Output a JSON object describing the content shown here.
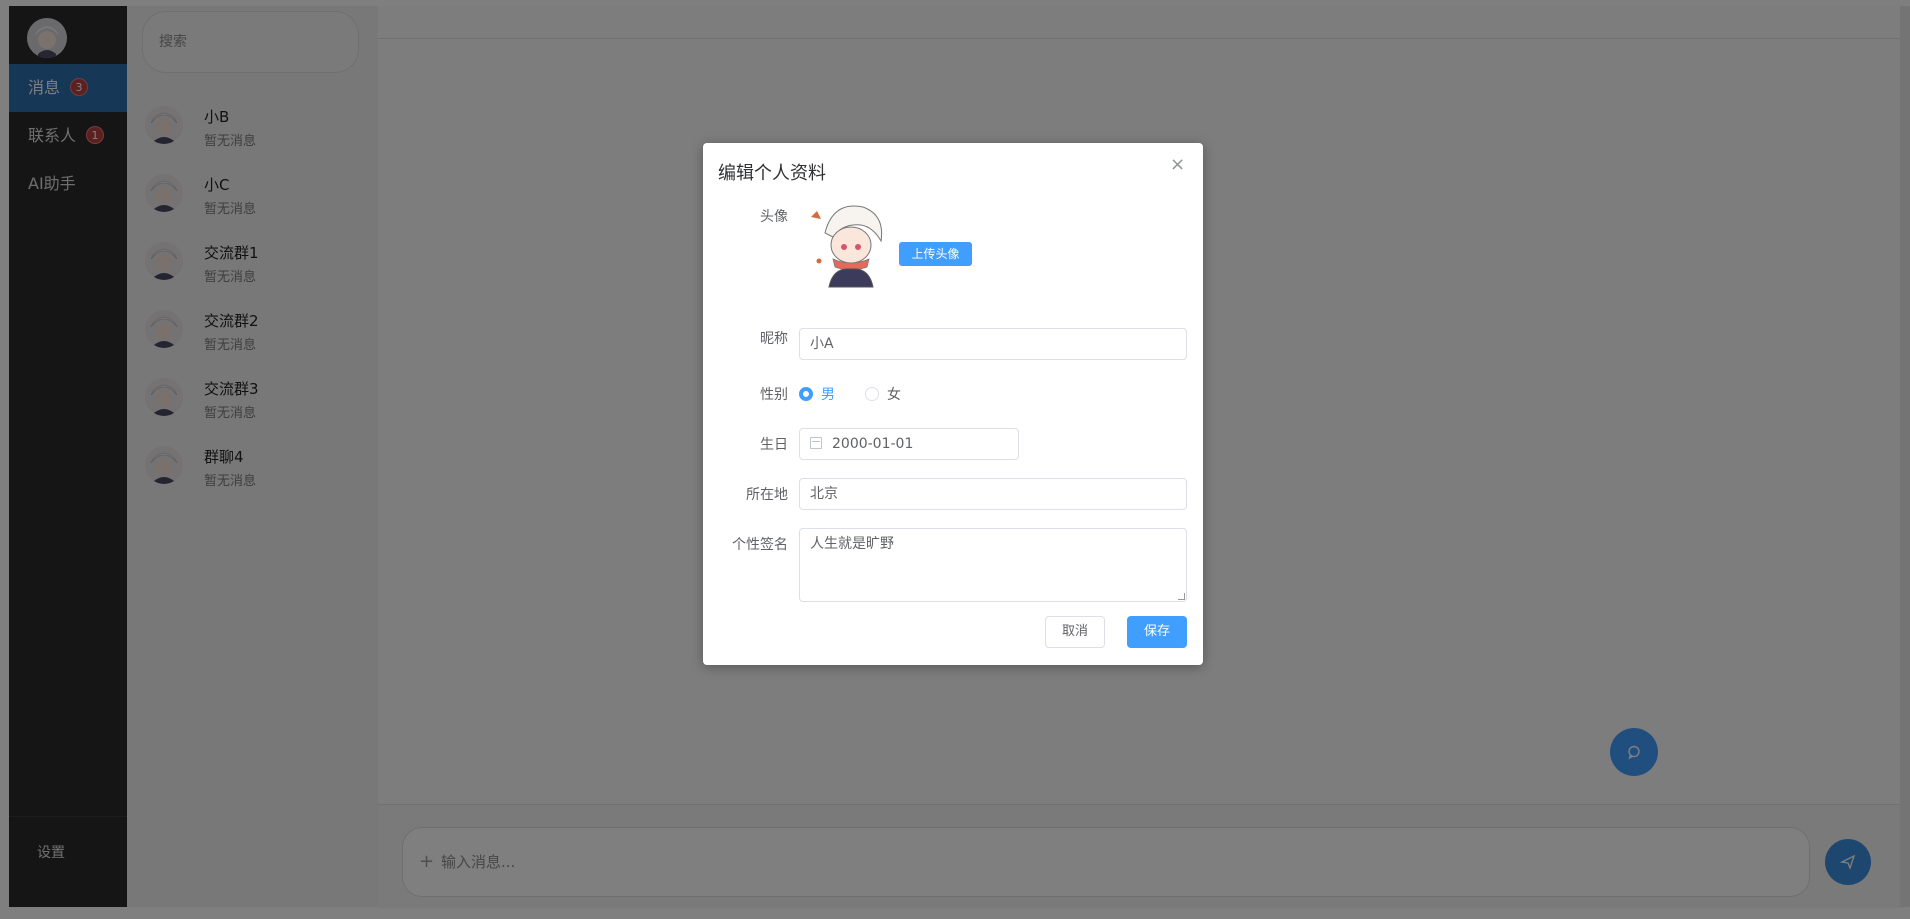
{
  "nav": {
    "items": [
      {
        "label": "消息",
        "badge": "3"
      },
      {
        "label": "联系人",
        "badge": "1"
      },
      {
        "label": "AI助手"
      }
    ],
    "settings_label": "设置"
  },
  "search": {
    "placeholder": "搜索"
  },
  "conversations": [
    {
      "name": "小B",
      "preview": "暂无消息"
    },
    {
      "name": "小C",
      "preview": "暂无消息"
    },
    {
      "name": "交流群1",
      "preview": "暂无消息"
    },
    {
      "name": "交流群2",
      "preview": "暂无消息"
    },
    {
      "name": "交流群3",
      "preview": "暂无消息"
    },
    {
      "name": "群聊4",
      "preview": "暂无消息"
    }
  ],
  "composer": {
    "placeholder": "输入消息...",
    "plus_icon": "+"
  },
  "dialog": {
    "title": "编辑个人资料",
    "close_icon": "×",
    "avatar_label": "头像",
    "upload_label": "上传头像",
    "nickname_label": "昵称",
    "nickname_value": "小A",
    "gender_label": "性别",
    "gender_options": [
      "男",
      "女"
    ],
    "gender_selected": "男",
    "birthday_label": "生日",
    "birthday_value": "2000-01-01",
    "location_label": "所在地",
    "location_value": "北京",
    "signature_label": "个性签名",
    "signature_value": "人生就是旷野",
    "cancel_label": "取消",
    "save_label": "保存"
  },
  "colors": {
    "primary": "#409eff",
    "nav_bg": "#2b2b2b",
    "nav_active": "#2f6fae",
    "badge": "#b94141"
  },
  "icons": {
    "send": "send-icon",
    "chat_bubble": "chat-bubble-icon",
    "calendar": "calendar-icon",
    "close": "close-icon"
  }
}
